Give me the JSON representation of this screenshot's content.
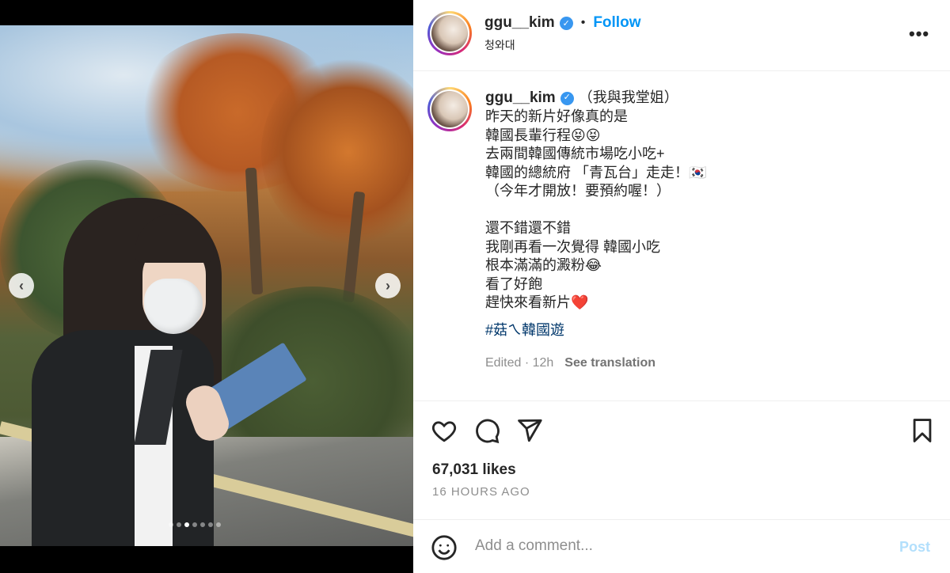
{
  "post_header": {
    "username": "ggu__kim",
    "verified_icon": "verified-badge-icon",
    "separator": "•",
    "follow_label": "Follow",
    "location": "청와대",
    "more_icon": "more-options-icon",
    "more_label": "•••"
  },
  "media": {
    "image_alt": "Woman in black jacket and white face mask reading a blue pamphlet beside autumn trees",
    "prev_label": "‹",
    "next_label": "›",
    "carousel_count": 7,
    "carousel_active_index": 2
  },
  "caption": {
    "username": "ggu__kim",
    "lines": [
      "（我與我堂姐）",
      "昨天的新片好像真的是",
      "韓國長輩行程😝😝",
      "去兩間韓國傳統市場吃小吃+",
      "韓國的總統府 「青瓦台」走走！🇰🇷",
      "（今年才開放！要預約喔！）",
      "",
      "還不錯還不錯",
      "我剛再看一次覺得 韓國小吃",
      "根本滿滿的澱粉😂",
      "看了好飽",
      "趕快來看新片❤️"
    ],
    "hashtag": "#菇ㄟ韓國遊",
    "edited": "Edited · 12h",
    "see_translation": "See translation"
  },
  "actions": {
    "like_icon": "heart-icon",
    "comment_icon": "comment-icon",
    "share_icon": "share-icon",
    "save_icon": "bookmark-icon",
    "likes": "67,031 likes",
    "time_ago": "16 HOURS AGO"
  },
  "comment": {
    "emoji_icon": "emoji-icon",
    "placeholder": "Add a comment...",
    "post_label": "Post"
  },
  "colors": {
    "accent": "#0095f6",
    "verified": "#3897f0",
    "hashtag": "#00376b",
    "post_disabled": "#b2dffc"
  }
}
